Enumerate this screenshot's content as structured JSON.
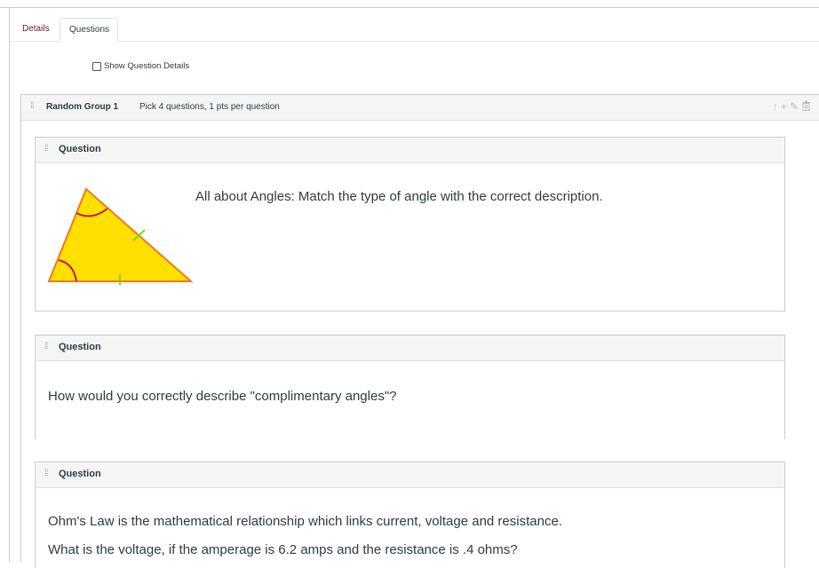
{
  "tabs": [
    {
      "label": "Details"
    },
    {
      "label": "Questions"
    }
  ],
  "show_details": {
    "label": "Show Question Details",
    "checked": false
  },
  "group": {
    "title": "Random Group 1",
    "pick": "Pick 4 questions, 1 pts per question",
    "actions": [
      "arrow-up-icon",
      "plus-icon",
      "pencil-icon",
      "trash-icon"
    ]
  },
  "questions": [
    {
      "title": "Question",
      "text": "All about Angles: Match the type of angle with the correct description.",
      "image": "triangle-angles-figure"
    },
    {
      "title": "Question",
      "text": "How would you correctly describe \"complimentary angles\"?"
    },
    {
      "title": "Question",
      "text": "Ohm's Law is the mathematical relationship which links current, voltage and resistance.",
      "text2": "What is the voltage, if the amperage is 6.2 amps and the resistance is .4 ohms?"
    }
  ],
  "colors": {
    "tab_active_text": "#5f1f33",
    "header_bg": "#f5f5f5",
    "border": "#c7cdd1",
    "triangle_fill": "#ffe000",
    "triangle_stroke": "#f07a1a",
    "angle_arc": "#c2185b",
    "tick_mark": "#7cd41f"
  }
}
